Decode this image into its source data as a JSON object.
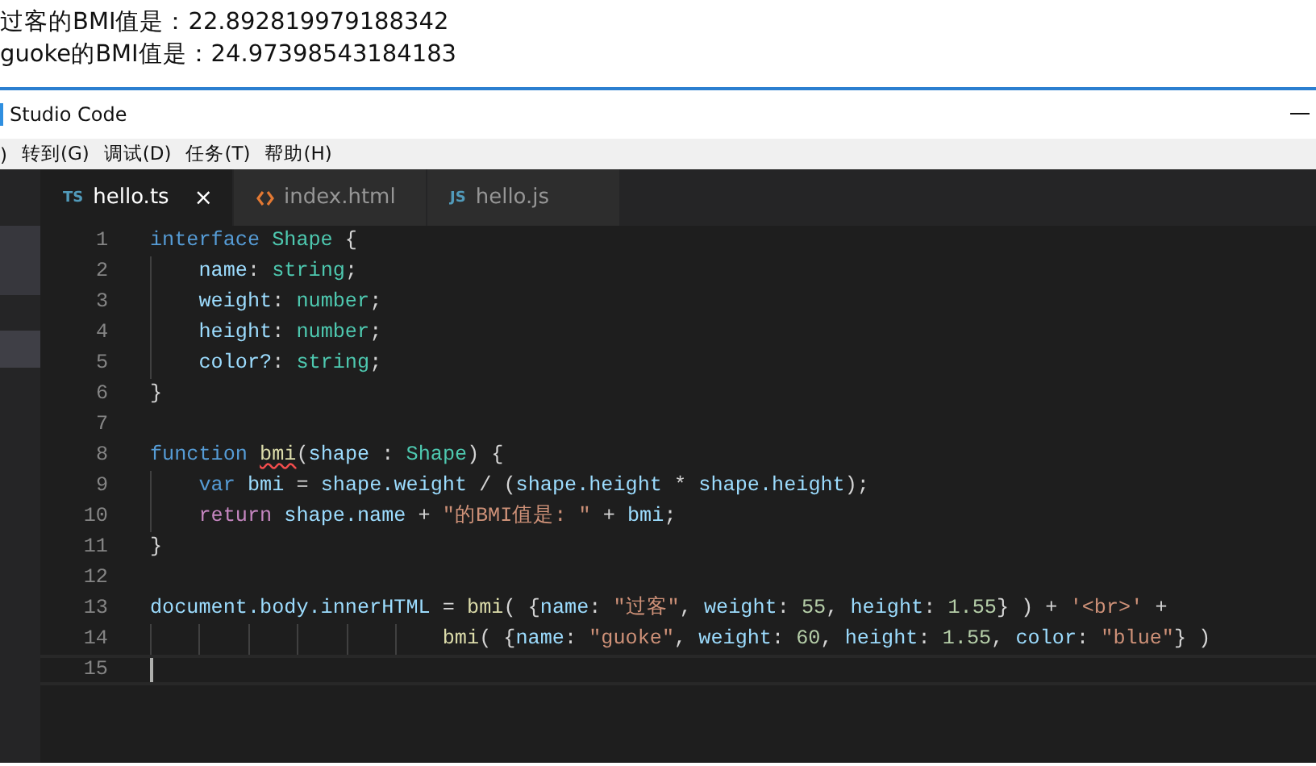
{
  "output_lines": [
    "过客的BMI值是：22.892819979188342",
    "guoke的BMI值是：24.97398543184183"
  ],
  "window": {
    "title": "Studio Code"
  },
  "menu": [
    ")",
    "转到(G)",
    "调试(D)",
    "任务(T)",
    "帮助(H)"
  ],
  "tabs": [
    {
      "kind": "script",
      "badge": "TS",
      "label": "hello.ts",
      "selected": true,
      "close": "×"
    },
    {
      "kind": "markup",
      "label": "index.html",
      "selected": false
    },
    {
      "kind": "script",
      "badge": "JS",
      "label": "hello.js",
      "selected": false
    }
  ],
  "editor": {
    "lines": [
      {
        "number": "1",
        "tokens": [
          {
            "kind": "keyword",
            "text": "interface "
          },
          {
            "kind": "type",
            "text": "Shape"
          },
          {
            "kind": "plain",
            "text": " {"
          }
        ]
      },
      {
        "number": "2",
        "tokens": [
          {
            "kind": "prop",
            "text": "    name"
          },
          {
            "kind": "plain",
            "text": ": "
          },
          {
            "kind": "type",
            "text": "string"
          },
          {
            "kind": "plain",
            "text": ";"
          }
        ]
      },
      {
        "number": "3",
        "tokens": [
          {
            "kind": "prop",
            "text": "    weight"
          },
          {
            "kind": "plain",
            "text": ": "
          },
          {
            "kind": "type",
            "text": "number"
          },
          {
            "kind": "plain",
            "text": ";"
          }
        ]
      },
      {
        "number": "4",
        "tokens": [
          {
            "kind": "prop",
            "text": "    height"
          },
          {
            "kind": "plain",
            "text": ": "
          },
          {
            "kind": "type",
            "text": "number"
          },
          {
            "kind": "plain",
            "text": ";"
          }
        ]
      },
      {
        "number": "5",
        "tokens": [
          {
            "kind": "prop",
            "text": "    color?"
          },
          {
            "kind": "plain",
            "text": ": "
          },
          {
            "kind": "type",
            "text": "string"
          },
          {
            "kind": "plain",
            "text": ";"
          }
        ]
      },
      {
        "number": "6",
        "tokens": [
          {
            "kind": "plain",
            "text": "}"
          }
        ]
      },
      {
        "number": "7"
      },
      {
        "number": "8",
        "tokens": [
          {
            "kind": "keyword",
            "text": "function "
          },
          {
            "kind": "func",
            "text": "bmi",
            "error": true
          },
          {
            "kind": "plain",
            "text": "("
          },
          {
            "kind": "prop",
            "text": "shape"
          },
          {
            "kind": "plain",
            "text": " : "
          },
          {
            "kind": "type",
            "text": "Shape"
          },
          {
            "kind": "plain",
            "text": ") {"
          }
        ]
      },
      {
        "number": "9",
        "tokens": [
          {
            "kind": "keyword",
            "text": "    var "
          },
          {
            "kind": "prop",
            "text": "bmi"
          },
          {
            "kind": "plain",
            "text": " = "
          },
          {
            "kind": "prop",
            "text": "shape.weight"
          },
          {
            "kind": "plain",
            "text": " / ("
          },
          {
            "kind": "prop",
            "text": "shape.height"
          },
          {
            "kind": "plain",
            "text": " * "
          },
          {
            "kind": "prop",
            "text": "shape.height"
          },
          {
            "kind": "plain",
            "text": ");"
          }
        ]
      },
      {
        "number": "10",
        "tokens": [
          {
            "kind": "control",
            "text": "    return "
          },
          {
            "kind": "prop",
            "text": "shape.name"
          },
          {
            "kind": "plain",
            "text": " + "
          },
          {
            "kind": "string",
            "text": "\"的BMI值是: \""
          },
          {
            "kind": "plain",
            "text": " + "
          },
          {
            "kind": "prop",
            "text": "bmi"
          },
          {
            "kind": "plain",
            "text": ";"
          }
        ]
      },
      {
        "number": "11",
        "tokens": [
          {
            "kind": "plain",
            "text": "}"
          }
        ]
      },
      {
        "number": "12"
      },
      {
        "number": "13",
        "tokens": [
          {
            "kind": "prop",
            "text": "document.body.innerHTML"
          },
          {
            "kind": "plain",
            "text": " = "
          },
          {
            "kind": "func",
            "text": "bmi"
          },
          {
            "kind": "plain",
            "text": "( {"
          },
          {
            "kind": "prop",
            "text": "name"
          },
          {
            "kind": "plain",
            "text": ": "
          },
          {
            "kind": "string",
            "text": "\"过客\""
          },
          {
            "kind": "plain",
            "text": ", "
          },
          {
            "kind": "prop",
            "text": "weight"
          },
          {
            "kind": "plain",
            "text": ": "
          },
          {
            "kind": "number",
            "text": "55"
          },
          {
            "kind": "plain",
            "text": ", "
          },
          {
            "kind": "prop",
            "text": "height"
          },
          {
            "kind": "plain",
            "text": ": "
          },
          {
            "kind": "number",
            "text": "1.55"
          },
          {
            "kind": "plain",
            "text": "} ) + "
          },
          {
            "kind": "string",
            "text": "'<br>'"
          },
          {
            "kind": "plain",
            "text": " +"
          }
        ]
      },
      {
        "number": "14",
        "tokens": [
          {
            "kind": "func",
            "text": "                        bmi"
          },
          {
            "kind": "plain",
            "text": "( {"
          },
          {
            "kind": "prop",
            "text": "name"
          },
          {
            "kind": "plain",
            "text": ": "
          },
          {
            "kind": "string",
            "text": "\"guoke\""
          },
          {
            "kind": "plain",
            "text": ", "
          },
          {
            "kind": "prop",
            "text": "weight"
          },
          {
            "kind": "plain",
            "text": ": "
          },
          {
            "kind": "number",
            "text": "60"
          },
          {
            "kind": "plain",
            "text": ", "
          },
          {
            "kind": "prop",
            "text": "height"
          },
          {
            "kind": "plain",
            "text": ": "
          },
          {
            "kind": "number",
            "text": "1.55"
          },
          {
            "kind": "plain",
            "text": ", "
          },
          {
            "kind": "prop",
            "text": "color"
          },
          {
            "kind": "plain",
            "text": ": "
          },
          {
            "kind": "string",
            "text": "\"blue\""
          },
          {
            "kind": "plain",
            "text": "} )"
          }
        ]
      },
      {
        "number": "15",
        "current": true
      }
    ]
  }
}
